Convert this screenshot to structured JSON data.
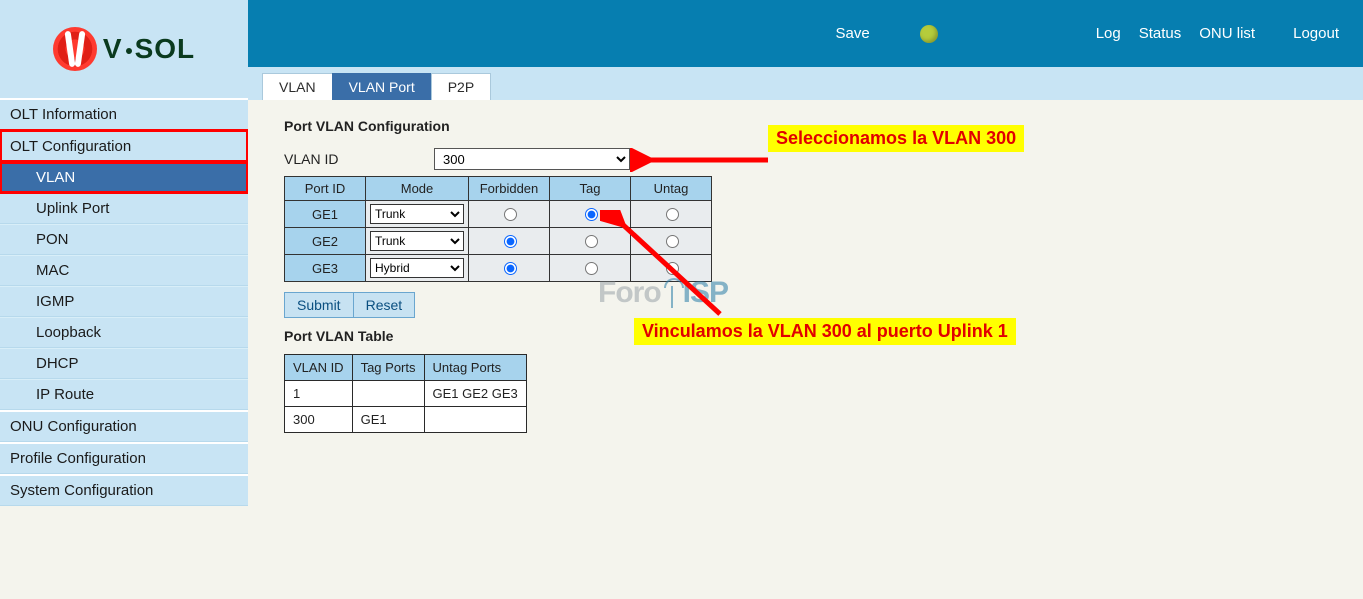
{
  "logo_text": "V·SOL",
  "topbar": {
    "save": "Save",
    "links": [
      "Log",
      "Status",
      "ONU list",
      "Logout"
    ]
  },
  "tabs": [
    {
      "label": "VLAN",
      "active": false
    },
    {
      "label": "VLAN Port",
      "active": true
    },
    {
      "label": "P2P",
      "active": false
    }
  ],
  "sidebar": [
    {
      "label": "OLT Information",
      "level": 0
    },
    {
      "label": "OLT Configuration",
      "level": 0,
      "highlight": true
    },
    {
      "label": "VLAN",
      "level": 1,
      "selected": true,
      "highlight": true
    },
    {
      "label": "Uplink Port",
      "level": 1
    },
    {
      "label": "PON",
      "level": 1
    },
    {
      "label": "MAC",
      "level": 1
    },
    {
      "label": "IGMP",
      "level": 1
    },
    {
      "label": "Loopback",
      "level": 1
    },
    {
      "label": "DHCP",
      "level": 1
    },
    {
      "label": "IP Route",
      "level": 1
    },
    {
      "label": "ONU Configuration",
      "level": 0
    },
    {
      "label": "Profile Configuration",
      "level": 0
    },
    {
      "label": "System Configuration",
      "level": 0
    }
  ],
  "main": {
    "section_title": "Port VLAN Configuration",
    "vlan_id_label": "VLAN ID",
    "vlan_id_value": "300",
    "port_table": {
      "headers": [
        "Port ID",
        "Mode",
        "Forbidden",
        "Tag",
        "Untag"
      ],
      "rows": [
        {
          "port": "GE1",
          "mode": "Trunk",
          "sel": "Tag"
        },
        {
          "port": "GE2",
          "mode": "Trunk",
          "sel": "Forbidden"
        },
        {
          "port": "GE3",
          "mode": "Hybrid",
          "sel": "Forbidden"
        }
      ]
    },
    "buttons": {
      "submit": "Submit",
      "reset": "Reset"
    },
    "vlan_table_title": "Port VLAN Table",
    "vlan_table": {
      "headers": [
        "VLAN ID",
        "Tag Ports",
        "Untag Ports"
      ],
      "rows": [
        {
          "id": "1",
          "tag": "",
          "untag": "GE1 GE2 GE3"
        },
        {
          "id": "300",
          "tag": "GE1",
          "untag": ""
        }
      ]
    }
  },
  "annotations": {
    "a1": "Seleccionamos la VLAN 300",
    "a2": "Vinculamos la VLAN 300 al puerto Uplink 1"
  },
  "watermark": {
    "part1": "Foro",
    "part2": "ISP"
  }
}
